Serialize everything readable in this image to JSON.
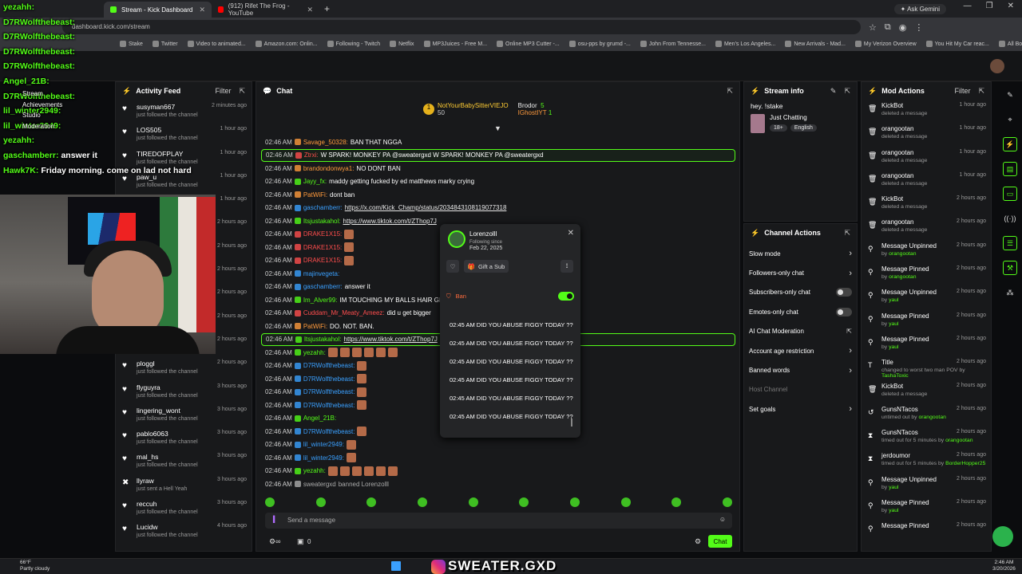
{
  "browser": {
    "tabs": [
      {
        "label": "Stream - Kick Dashboard",
        "active": true
      },
      {
        "label": "(912) Rifet The Frog - YouTube",
        "active": false
      }
    ],
    "ask_label": "Ask Gemini",
    "url": "dashboard.kick.com/stream",
    "bookmarks": [
      "Stake",
      "Twitter",
      "Video to animated...",
      "Amazon.com: Onlin...",
      "Following - Twitch",
      "Netflix",
      "MP3Juices - Free M...",
      "Online MP3 Cutter -...",
      "osu-pps by grumd -...",
      "John From Tennesse...",
      "Men's Los Angeles...",
      "New Arrivals - Mad...",
      "My Verizon Overview",
      "You Hit My Car reac...",
      "All Bookmarks"
    ]
  },
  "overlay_chat": [
    {
      "user": "yezahh:",
      "text": ""
    },
    {
      "user": "D7RWolfthebeast:",
      "text": ""
    },
    {
      "user": "D7RWolfthebeast:",
      "text": ""
    },
    {
      "user": "D7RWolfthebeast:",
      "text": ""
    },
    {
      "user": "D7RWolfthebeast:",
      "text": ""
    },
    {
      "user": "Angel_21B:",
      "text": ""
    },
    {
      "user": "D7RWolfthebeast:",
      "text": ""
    },
    {
      "user": "lil_winter2949:",
      "text": ""
    },
    {
      "user": "lil_winter2949:",
      "text": ""
    },
    {
      "user": "yezahh:",
      "text": ""
    },
    {
      "user": "gaschamberr:",
      "text": "answer it"
    },
    {
      "user": "Hawk7K:",
      "text": "Friday morning. come on lad not hard"
    }
  ],
  "sidebar_menu": [
    "Stream",
    "Achievements",
    "Studio",
    "Moderation"
  ],
  "activity_feed": {
    "title": "Activity Feed",
    "filter": "Filter",
    "items": [
      {
        "name": "susyman667",
        "sub": "just followed the channel",
        "time": "2 minutes ago"
      },
      {
        "name": "LOS505",
        "sub": "just followed the channel",
        "time": "1 hour ago"
      },
      {
        "name": "TIREDOFPLAY",
        "sub": "just followed the channel",
        "time": "1 hour ago"
      },
      {
        "name": "paw_u",
        "sub": "just followed the channel",
        "time": "1 hour ago"
      },
      {
        "name": "",
        "sub": "",
        "time": "1 hour ago"
      },
      {
        "name": "",
        "sub": "",
        "time": "2 hours ago"
      },
      {
        "name": "",
        "sub": "",
        "time": "2 hours ago"
      },
      {
        "name": "",
        "sub": "",
        "time": "2 hours ago"
      },
      {
        "name": "",
        "sub": "",
        "time": "2 hours ago"
      },
      {
        "name": "",
        "sub": "",
        "time": "2 hours ago"
      },
      {
        "name": "",
        "sub": "",
        "time": "2 hours ago"
      },
      {
        "name": "ploggl",
        "sub": "just followed the channel",
        "time": "2 hours ago"
      },
      {
        "name": "flyguyra",
        "sub": "just followed the channel",
        "time": "3 hours ago"
      },
      {
        "name": "lingering_wont",
        "sub": "just followed the channel",
        "time": "3 hours ago"
      },
      {
        "name": "pablo6063",
        "sub": "just followed the channel",
        "time": "3 hours ago"
      },
      {
        "name": "mal_hs",
        "sub": "just followed the channel",
        "time": "3 hours ago"
      },
      {
        "name": "llyraw",
        "sub": "just sent a Hell Yeah",
        "time": "3 hours ago"
      },
      {
        "name": "reccuh",
        "sub": "just followed the channel",
        "time": "3 hours ago"
      },
      {
        "name": "Lucidw",
        "sub": "just followed the channel",
        "time": "4 hours ago"
      }
    ]
  },
  "chat": {
    "title": "Chat",
    "gifters": [
      {
        "name": "NotYourBabySitterVIEJO",
        "count": "50"
      },
      {
        "name": "Brodor",
        "count": "5"
      },
      {
        "name": "IGhostIYT",
        "count": "1"
      }
    ],
    "messages": [
      {
        "time": "02:46 AM",
        "user": "Savage_50328:",
        "color": "#ff9a3c",
        "text": "BAN THAT NGGA",
        "hl": false
      },
      {
        "time": "02:46 AM",
        "user": "Ztrxi:",
        "color": "#ff4d4d",
        "text": "W SPARK! MONKEY PA @sweatergxd W SPARK! MONKEY PA @sweatergxd",
        "hl": true
      },
      {
        "time": "02:46 AM",
        "user": "brandondonwya1:",
        "color": "#ff9a3c",
        "text": "NO DONT BAN",
        "hl": false
      },
      {
        "time": "02:46 AM",
        "user": "Jayy_fx:",
        "color": "#53fc18",
        "text": "maddy getting fucked by ed matthews marky crying",
        "hl": false
      },
      {
        "time": "02:46 AM",
        "user": "PatWiFi:",
        "color": "#ff9a3c",
        "text": "dont ban",
        "hl": false
      },
      {
        "time": "02:46 AM",
        "user": "gaschamberr:",
        "color": "#3aa0ff",
        "text": "https://x.com/Kick_Champ/status/2034843108119077318",
        "hl": false,
        "link": true
      },
      {
        "time": "02:46 AM",
        "user": "Itsjustakahol:",
        "color": "#53fc18",
        "text": "https://www.tiktok.com/t/ZThop7J",
        "hl": false,
        "link": true
      },
      {
        "time": "02:46 AM",
        "user": "DRAKE1X15:",
        "color": "#ff4d4d",
        "text": "",
        "hl": false,
        "emote": true
      },
      {
        "time": "02:46 AM",
        "user": "DRAKE1X15:",
        "color": "#ff4d4d",
        "text": "",
        "hl": false,
        "emote": true
      },
      {
        "time": "02:46 AM",
        "user": "DRAKE1X15:",
        "color": "#ff4d4d",
        "text": "",
        "hl": false,
        "emote": true
      },
      {
        "time": "02:46 AM",
        "user": "majinvegeta:",
        "color": "#3aa0ff",
        "text": "",
        "hl": false
      },
      {
        "time": "02:46 AM",
        "user": "gaschamberr:",
        "color": "#3aa0ff",
        "text": "answer it",
        "hl": false
      },
      {
        "time": "02:46 AM",
        "user": "Im_Alver99:",
        "color": "#53fc18",
        "text": "IM TOUCHING MY BALLS HAIR GET ON",
        "hl": false
      },
      {
        "time": "02:46 AM",
        "user": "Cuddam_Mr_Meaty_Ameez:",
        "color": "#ff4d4d",
        "text": "did u get bigger",
        "hl": false
      },
      {
        "time": "02:46 AM",
        "user": "PatWiFi:",
        "color": "#ff9a3c",
        "text": "DO. NOT. BAN.",
        "hl": false
      },
      {
        "time": "02:46 AM",
        "user": "Itsjustakahol:",
        "color": "#53fc18",
        "text": "https://www.tiktok.com/t/ZThop7J",
        "hl": true,
        "link": true
      },
      {
        "time": "02:46 AM",
        "user": "yezahh:",
        "color": "#53fc18",
        "text": "",
        "hl": false,
        "emote": true
      },
      {
        "time": "02:46 AM",
        "user": "D7RWolfthebeast:",
        "color": "#3aa0ff",
        "text": "",
        "hl": false,
        "emote": true
      },
      {
        "time": "02:46 AM",
        "user": "D7RWolfthebeast:",
        "color": "#3aa0ff",
        "text": "",
        "hl": false,
        "emote": true
      },
      {
        "time": "02:46 AM",
        "user": "D7RWolfthebeast:",
        "color": "#3aa0ff",
        "text": "",
        "hl": false,
        "emote": true
      },
      {
        "time": "02:46 AM",
        "user": "D7RWolfthebeast:",
        "color": "#3aa0ff",
        "text": "",
        "hl": false,
        "emote": true
      },
      {
        "time": "02:46 AM",
        "user": "Angel_21B:",
        "color": "#53fc18",
        "text": "",
        "hl": false
      },
      {
        "time": "02:46 AM",
        "user": "D7RWolfthebeast:",
        "color": "#3aa0ff",
        "text": "",
        "hl": false,
        "emote": true
      },
      {
        "time": "02:46 AM",
        "user": "lil_winter2949:",
        "color": "#3aa0ff",
        "text": "",
        "hl": false,
        "emote": true
      },
      {
        "time": "02:46 AM",
        "user": "lil_winter2949:",
        "color": "#3aa0ff",
        "text": "",
        "hl": false,
        "emote": true
      },
      {
        "time": "02:46 AM",
        "user": "yezahh:",
        "color": "#53fc18",
        "text": "",
        "hl": false,
        "emote": true
      },
      {
        "time": "02:46 AM",
        "user": "sweatergxd",
        "color": "#aaaaaa",
        "text": "banned Lorenzolll",
        "hl": false,
        "system": true
      }
    ],
    "input_placeholder": "Send a message",
    "point_count": "0",
    "send_label": "Chat"
  },
  "user_card": {
    "name": "Lorenzolll",
    "following_since_label": "Following since",
    "following_date": "Feb 22, 2025",
    "gift_label": "Gift a Sub",
    "ban_label": "Ban",
    "history": [
      "02:45 AM DID YOU ABUSE FIGGY TODAY ??",
      "02:45 AM DID YOU ABUSE FIGGY TODAY ??",
      "02:45 AM DID YOU ABUSE FIGGY TODAY ??",
      "02:45 AM DID YOU ABUSE FIGGY TODAY ??",
      "02:45 AM DID YOU ABUSE FIGGY TODAY ??",
      "02:45 AM DID YOU ABUSE FIGGY TODAY ??"
    ]
  },
  "stream_info": {
    "title": "Stream info",
    "stream_title": "hey. !stake",
    "category": "Just Chatting",
    "tags": [
      "18+",
      "English"
    ]
  },
  "channel_actions": {
    "title": "Channel Actions",
    "items": [
      {
        "label": "Slow mode",
        "control": "chevron"
      },
      {
        "label": "Followers-only chat",
        "control": "chevron"
      },
      {
        "label": "Subscribers-only chat",
        "control": "toggle-off"
      },
      {
        "label": "Emotes-only chat",
        "control": "toggle-off"
      },
      {
        "label": "AI Chat Moderation",
        "control": "external"
      },
      {
        "label": "Account age restriction",
        "control": "chevron"
      },
      {
        "label": "Banned words",
        "control": "chevron"
      },
      {
        "label": "Host Channel",
        "control": "disabled"
      },
      {
        "label": "Set goals",
        "control": "chevron"
      }
    ]
  },
  "mod_actions": {
    "title": "Mod Actions",
    "filter": "Filter",
    "items": [
      {
        "icon": "trash",
        "name": "KickBot",
        "sub": "deleted a message",
        "by": "",
        "time": "1 hour ago"
      },
      {
        "icon": "trash",
        "name": "orangootan",
        "sub": "deleted a message",
        "by": "",
        "time": "1 hour ago"
      },
      {
        "icon": "trash",
        "name": "orangootan",
        "sub": "deleted a message",
        "by": "",
        "time": "1 hour ago"
      },
      {
        "icon": "trash",
        "name": "orangootan",
        "sub": "deleted a message",
        "by": "",
        "time": "1 hour ago"
      },
      {
        "icon": "trash",
        "name": "KickBot",
        "sub": "deleted a message",
        "by": "",
        "time": "2 hours ago"
      },
      {
        "icon": "trash",
        "name": "orangootan",
        "sub": "deleted a message",
        "by": "",
        "time": "2 hours ago"
      },
      {
        "icon": "pin",
        "name": "Message Unpinned",
        "sub": "by ",
        "by": "orangootan",
        "time": "2 hours ago"
      },
      {
        "icon": "pin",
        "name": "Message Pinned",
        "sub": "by ",
        "by": "orangootan",
        "time": "2 hours ago"
      },
      {
        "icon": "pin",
        "name": "Message Unpinned",
        "sub": "by ",
        "by": "yaul",
        "time": "2 hours ago"
      },
      {
        "icon": "pin",
        "name": "Message Pinned",
        "sub": "by ",
        "by": "yaul",
        "time": "2 hours ago"
      },
      {
        "icon": "pin",
        "name": "Message Pinned",
        "sub": "by ",
        "by": "yaul",
        "time": "2 hours ago"
      },
      {
        "icon": "title",
        "name": "Title",
        "sub": "changed to worst two man POV by ",
        "by": "TashaToxic",
        "time": "2 hours ago"
      },
      {
        "icon": "trash",
        "name": "KickBot",
        "sub": "deleted a message",
        "by": "",
        "time": "2 hours ago"
      },
      {
        "icon": "undo",
        "name": "GunsNTacos",
        "sub": "untimed out by ",
        "by": "orangootan",
        "time": "2 hours ago"
      },
      {
        "icon": "timer",
        "name": "GunsNTacos",
        "sub": "timed out for 5 minutes by ",
        "by": "orangootan",
        "time": "2 hours ago"
      },
      {
        "icon": "timer",
        "name": "jerdoumor",
        "sub": "timed out for 5 minutes by ",
        "by": "BorderHopper25",
        "time": "2 hours ago"
      },
      {
        "icon": "pin",
        "name": "Message Unpinned",
        "sub": "by ",
        "by": "yaul",
        "time": "2 hours ago"
      },
      {
        "icon": "pin",
        "name": "Message Pinned",
        "sub": "by ",
        "by": "yaul",
        "time": "2 hours ago"
      },
      {
        "icon": "pin",
        "name": "Message Pinned",
        "sub": "",
        "by": "",
        "time": "2 hours ago"
      }
    ]
  },
  "taskbar": {
    "temp": "66°F",
    "weather": "Partly cloudy",
    "brand": "SWEATER.GXD",
    "time": "2:46 AM",
    "date": "3/20/2026"
  },
  "colors": {
    "accent": "#53fc18",
    "bg": "#0b0c0e",
    "panel": "#18191b"
  }
}
